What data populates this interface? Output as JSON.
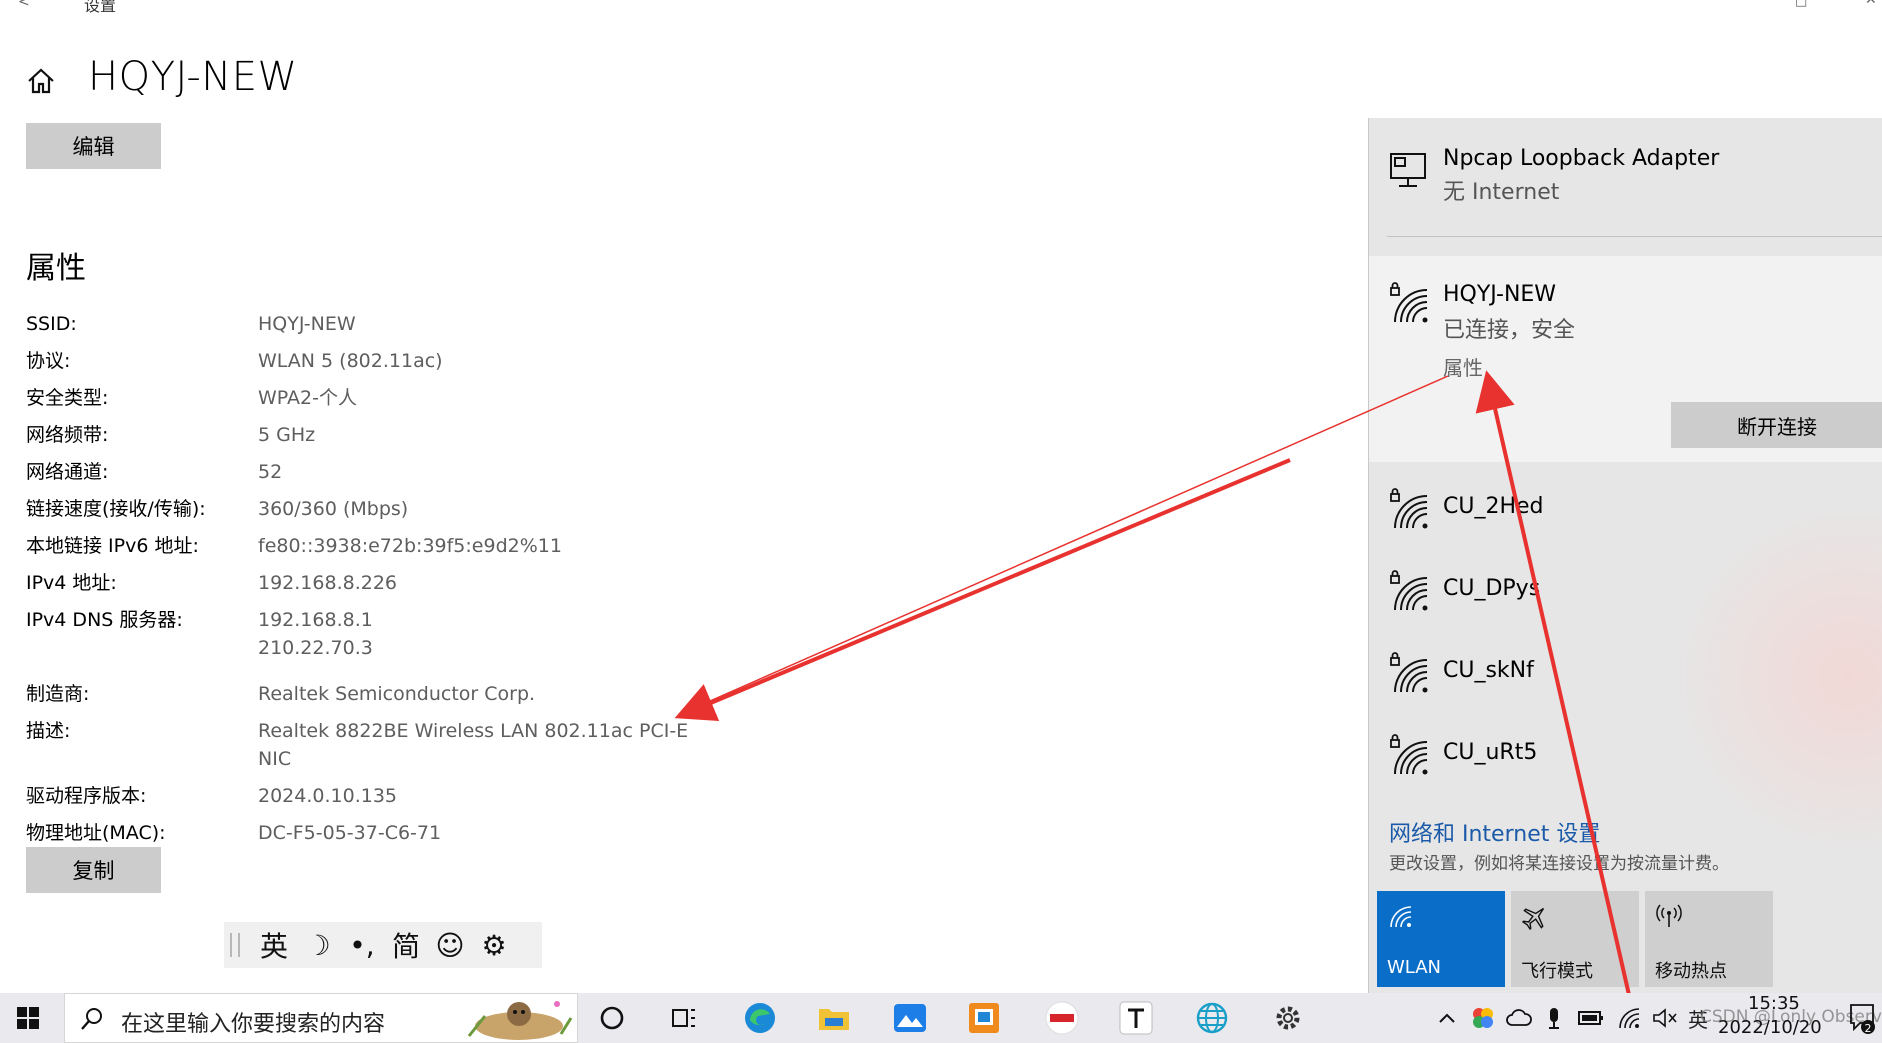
{
  "window": {
    "back_glyph": "<",
    "title": "设置",
    "maximize_glyph": "□",
    "close_glyph": "✕"
  },
  "page": {
    "title": "HQYJ-NEW",
    "edit_label": "编辑",
    "section_title": "属性",
    "copy_label": "复制"
  },
  "properties": [
    {
      "label": "SSID:",
      "values": [
        "HQYJ-NEW"
      ]
    },
    {
      "label": "协议:",
      "values": [
        "WLAN 5 (802.11ac)"
      ]
    },
    {
      "label": "安全类型:",
      "values": [
        "WPA2-个人"
      ]
    },
    {
      "label": "网络频带:",
      "values": [
        "5 GHz"
      ]
    },
    {
      "label": "网络通道:",
      "values": [
        "52"
      ]
    },
    {
      "label": "链接速度(接收/传输):",
      "values": [
        "360/360 (Mbps)"
      ]
    },
    {
      "label": "本地链接 IPv6 地址:",
      "values": [
        "fe80::3938:e72b:39f5:e9d2%11"
      ]
    },
    {
      "label": "IPv4 地址:",
      "values": [
        "192.168.8.226"
      ]
    },
    {
      "label": "IPv4 DNS 服务器:",
      "values": [
        "192.168.8.1",
        "210.22.70.3"
      ]
    },
    {
      "label": "制造商:",
      "values": [
        "Realtek Semiconductor Corp."
      ]
    },
    {
      "label": "描述:",
      "values": [
        "Realtek 8822BE Wireless LAN 802.11ac PCI-E",
        "NIC"
      ]
    },
    {
      "label": "驱动程序版本:",
      "values": [
        "2024.0.10.135"
      ]
    },
    {
      "label": "物理地址(MAC):",
      "values": [
        "DC-F5-05-37-C6-71"
      ]
    }
  ],
  "ime": {
    "lang": "英",
    "moon": "☽",
    "punct": "•,",
    "simplified": "简",
    "emoji": "☺",
    "gear": "⚙"
  },
  "flyout": {
    "adapter_name": "Npcap Loopback Adapter",
    "adapter_status": "无 Internet",
    "active_name": "HQYJ-NEW",
    "active_status": "已连接，安全",
    "properties_link": "属性",
    "disconnect_label": "断开连接",
    "networks": [
      "CU_2Hed",
      "CU_DPys",
      "CU_skNf",
      "CU_uRt5"
    ],
    "settings_link": "网络和 Internet 设置",
    "settings_desc": "更改设置，例如将某连接设置为按流量计费。",
    "quick_actions": [
      {
        "label": "WLAN",
        "icon": "wifi-icon",
        "active": true
      },
      {
        "label": "飞行模式",
        "icon": "airplane-icon",
        "active": false
      },
      {
        "label": "移动热点",
        "icon": "hotspot-icon",
        "active": false
      }
    ],
    "accent_color": "#0a6dc8"
  },
  "taskbar": {
    "search_placeholder": "在这里输入你要搜索的内容",
    "time": "15:35",
    "date": "2022/10/20",
    "ime_lang": "英",
    "watermark": "CSDN @Lonly Observe",
    "notification_count": "2"
  },
  "annotation_color": "#e8322f"
}
